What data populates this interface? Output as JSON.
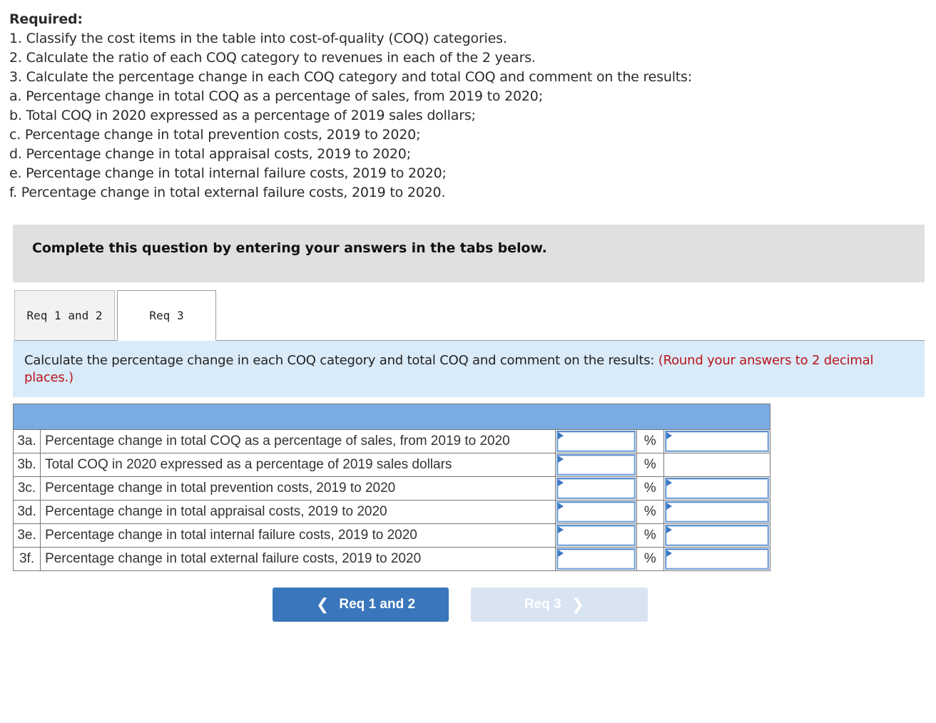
{
  "required": {
    "title": "Required:",
    "lines": [
      "1. Classify the cost items in the table into cost-of-quality (COQ) categories.",
      "2. Calculate the ratio of each COQ category to revenues in each of the 2 years.",
      "3. Calculate the percentage change in each COQ category and total COQ and comment on the results:",
      "a. Percentage change in total COQ as a percentage of sales, from 2019 to 2020;",
      "b. Total COQ in 2020 expressed as a percentage of 2019 sales dollars;",
      "c. Percentage change in total prevention costs, 2019 to 2020;",
      "d. Percentage change in total appraisal costs, 2019 to 2020;",
      "e. Percentage change in total internal failure costs, 2019 to 2020;",
      "f. Percentage change in total external failure costs, 2019 to 2020."
    ]
  },
  "banner": {
    "text": "Complete this question by entering your answers in the tabs below."
  },
  "tabs": [
    {
      "label": "Req 1 and 2",
      "active": false
    },
    {
      "label": "Req 3",
      "active": true
    }
  ],
  "instruction": {
    "text": "Calculate the percentage change in each COQ category and total COQ and comment on the results: ",
    "note": "(Round your answers to 2 decimal places.)"
  },
  "table": {
    "rows": [
      {
        "num": "3a.",
        "desc": "Percentage change in total COQ as a percentage of sales, from 2019 to 2020",
        "value": "",
        "unit": "%",
        "comment": "",
        "has_comment": true
      },
      {
        "num": "3b.",
        "desc": "Total COQ in 2020 expressed as a percentage of 2019 sales dollars",
        "value": "",
        "unit": "%",
        "comment": "",
        "has_comment": false
      },
      {
        "num": "3c.",
        "desc": "Percentage change in total prevention costs, 2019 to 2020",
        "value": "",
        "unit": "%",
        "comment": "",
        "has_comment": true
      },
      {
        "num": "3d.",
        "desc": "Percentage change in total appraisal costs, 2019 to 2020",
        "value": "",
        "unit": "%",
        "comment": "",
        "has_comment": true
      },
      {
        "num": "3e.",
        "desc": "Percentage change in total internal failure costs, 2019 to 2020",
        "value": "",
        "unit": "%",
        "comment": "",
        "has_comment": true
      },
      {
        "num": "3f.",
        "desc": "Percentage change in total external failure costs, 2019 to 2020",
        "value": "",
        "unit": "%",
        "comment": "",
        "has_comment": true
      }
    ]
  },
  "nav": {
    "prev_label": "Req 1 and 2",
    "prev_icon": "chevron-left-icon",
    "next_label": "Req 3",
    "next_icon": "chevron-right-icon",
    "next_disabled": true
  },
  "colors": {
    "header_blue": "#7aabe2",
    "instruction_bg": "#d9eaf8",
    "note_red": "#b8141a",
    "button_blue": "#3a76bb",
    "button_disabled": "#d8e4f2"
  }
}
